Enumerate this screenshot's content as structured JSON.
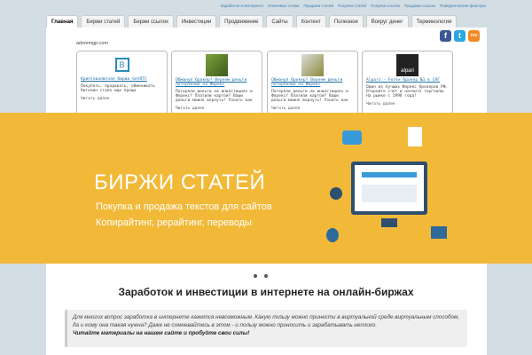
{
  "top_links": [
    "Заработок в Интернете",
    "Ключевые слова",
    "Продажа статей",
    "Покупка статей",
    "Покупка ссылок",
    "Продажа ссылок",
    "Поведенческие факторы"
  ],
  "tabs": [
    "Главная",
    "Биржи статей",
    "Биржи ссылок",
    "Инвестиции",
    "Продвижение",
    "Сайты",
    "Контент",
    "Полезное",
    "Вокруг денег",
    "Терминология"
  ],
  "site_label": "adsmmgp.com",
  "social": {
    "facebook": "f",
    "twitter": "t",
    "rss": "rss"
  },
  "ads": [
    {
      "title": "Криптовалютная биржа GetBTC",
      "desc": "Покупать, продавать, обменивать биткоин стало еще проще",
      "read": "Читать далее"
    },
    {
      "title": "Обманул брокер? Вернем деньги потерянные на Форекс",
      "desc": "Потеряли деньги на инвестициях и Форекс? Платили картой? Ваши деньги можно вернуть! Узнать как",
      "read": "Читать далее"
    },
    {
      "title": "Обманул брокер? Вернем деньги потерянные на Форекс",
      "desc": "Потеряли деньги на инвестициях и Форекс? Платили картой? Ваши деньги можно вернуть! Узнать как",
      "read": "Читать далее"
    },
    {
      "title": "Alpari - Forex брокер №1 в СНГ",
      "desc": "Один из лучших Форекс брокеров РФ. Откройте счет и начните торговлю. На рынке с 1998 года!",
      "read": "Читать далее",
      "logo": "alpari"
    }
  ],
  "banner": {
    "title": "БИРЖИ СТАТЕЙ",
    "line1": "Покупка и продажа текстов для сайтов",
    "line2": "Копирайтинг, рерайтинг, переводы",
    "bg": "#f2b938"
  },
  "heading": "Заработок и инвестиции в интернете на онлайн-биржах",
  "intro": {
    "text": "Для многих вопрос заработка в интернете кажется невозможным. Какую пользу можно принести в виртуальной среде виртуальным способом, да и кому она такая нужна? Даже не сомневайтесь в этом - и пользу можно приносить и зарабатывать неплохо.",
    "bold": "Читайте материалы на нашем сайте и пробуйте свои силы!"
  }
}
